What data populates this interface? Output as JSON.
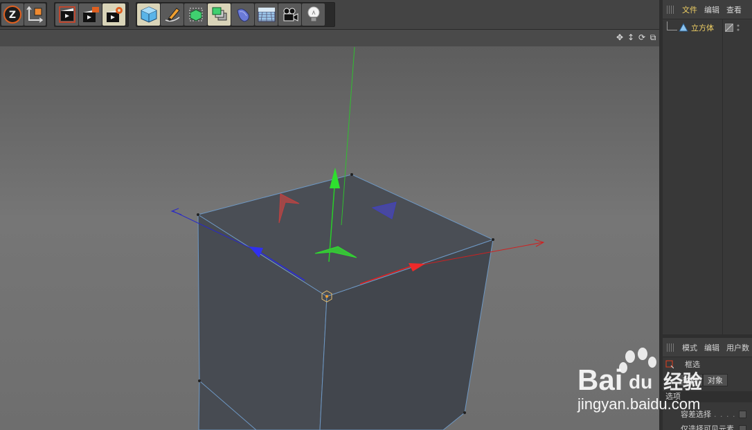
{
  "object_manager": {
    "menu": [
      "文件",
      "编辑",
      "查看"
    ],
    "object_name": "立方体"
  },
  "attribute_manager": {
    "menu": [
      "模式",
      "编辑",
      "用户数"
    ],
    "tool_name": "框选",
    "tabs": [
      "轴向",
      "对象"
    ],
    "section": "选项",
    "options": [
      {
        "label": "容差选择",
        "dots": ". . . . ."
      },
      {
        "label": "仅选择可见元素",
        "dots": ""
      }
    ]
  },
  "watermark": {
    "brand": "Bai",
    "brand_du": "du",
    "jingyan": "经验",
    "url": "jingyan.baidu.com"
  },
  "toolbar": {
    "icons": [
      "undo-z-icon",
      "coordinate-axes-icon",
      "render-view-icon",
      "render-picture-viewer-icon",
      "render-settings-icon",
      "cube-icon",
      "pen-spline-icon",
      "subdivision-icon",
      "array-icon",
      "deformer-icon",
      "floor-icon",
      "camera-icon",
      "light-icon"
    ]
  },
  "colors": {
    "x_axis": "#e02020",
    "y_axis": "#20d020",
    "z_axis": "#2020e0",
    "highlight_text": "#f0d064",
    "cube_face": "#4a4e55"
  }
}
